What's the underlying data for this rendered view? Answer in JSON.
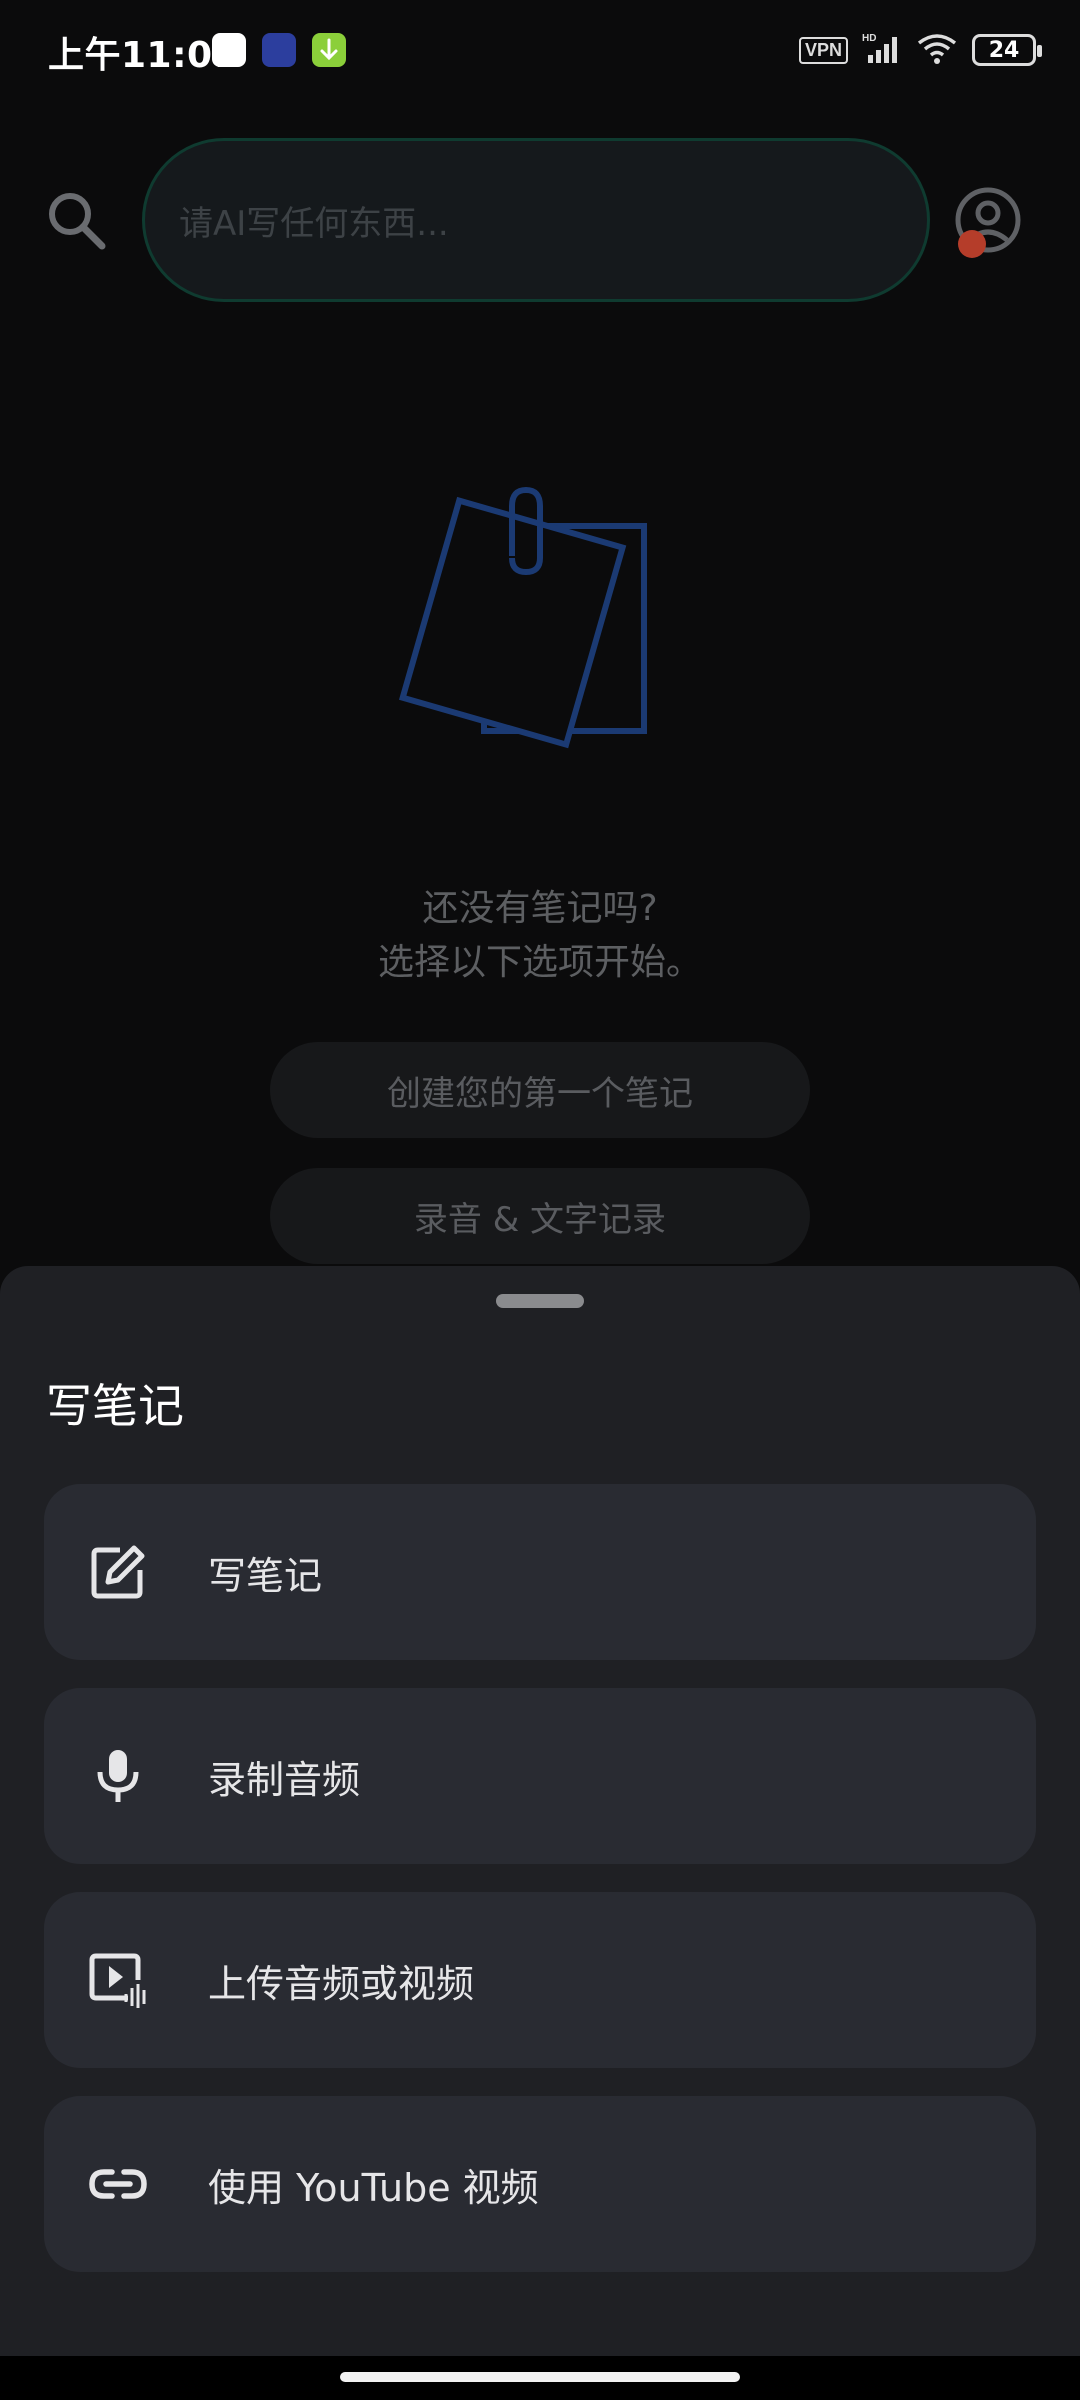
{
  "status_bar": {
    "time": "上午11:07",
    "vpn": "VPN",
    "network": "HD",
    "battery": "24"
  },
  "search": {
    "placeholder": "请AI写任何东西..."
  },
  "empty_state": {
    "line1": "还没有笔记吗?",
    "line2": "选择以下选项开始。",
    "create_first_note": "创建您的第一个笔记",
    "record_and_transcribe": "录音 & 文字记录"
  },
  "sheet": {
    "title": "写笔记",
    "options": [
      {
        "label": "写笔记",
        "icon": "edit-note-icon"
      },
      {
        "label": "录制音频",
        "icon": "microphone-icon"
      },
      {
        "label": "上传音频或视频",
        "icon": "upload-media-icon"
      },
      {
        "label": "使用 YouTube 视频",
        "icon": "link-icon"
      }
    ]
  },
  "colors": {
    "background": "#0b0b0c",
    "sheet": "#1f2024",
    "option_card": "#292b32",
    "illustration_blue": "#1b3a73",
    "search_border": "#0f3b30"
  }
}
